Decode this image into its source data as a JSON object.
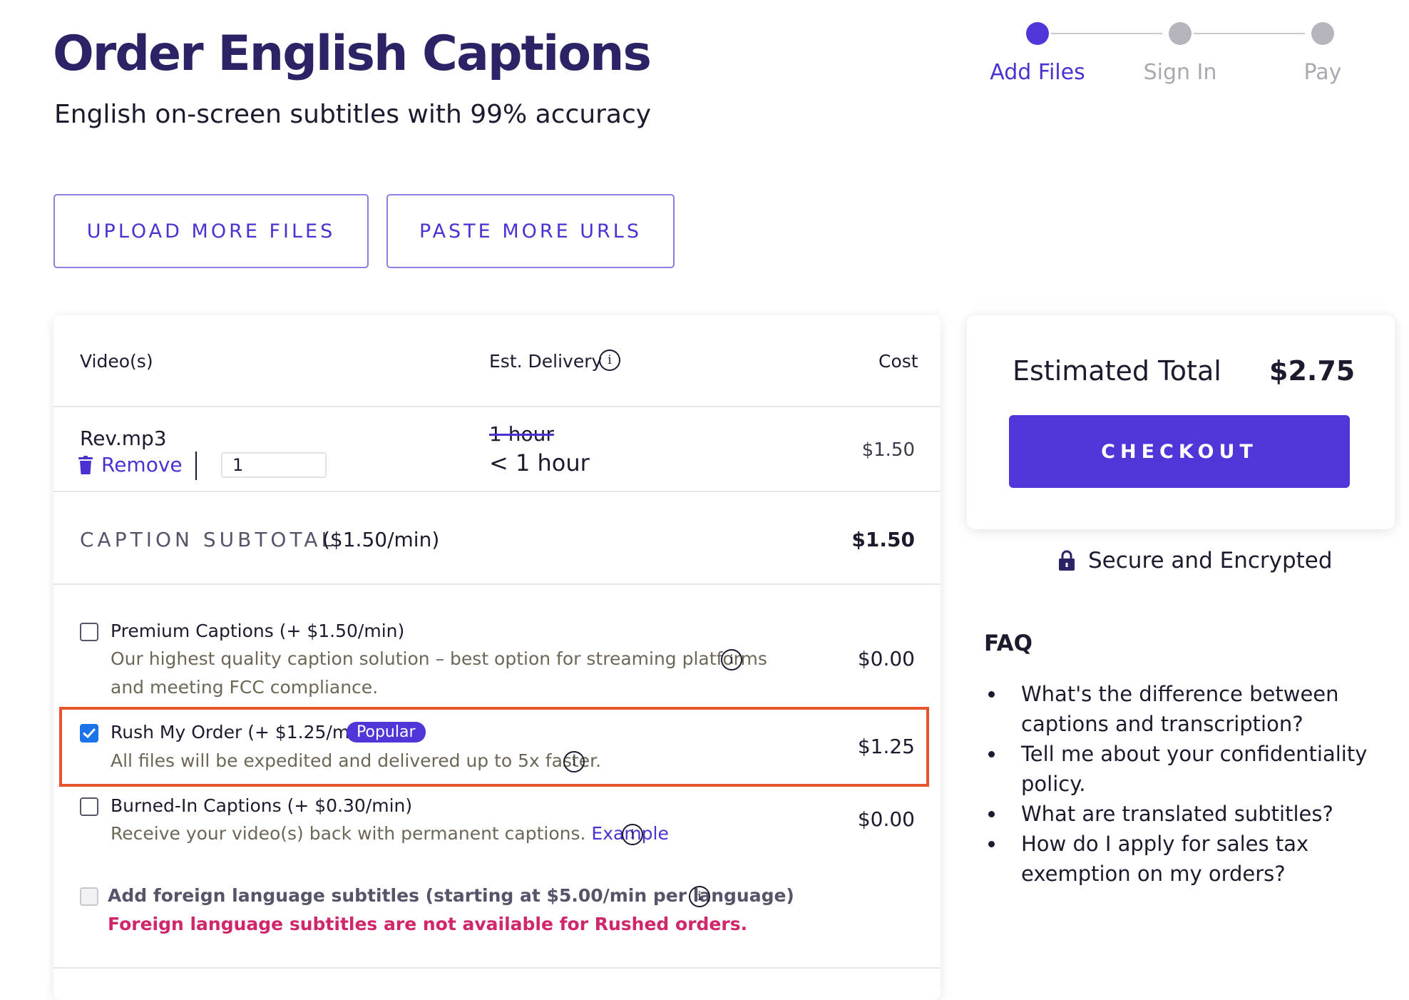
{
  "header": {
    "title": "Order English Captions",
    "subtitle": "English on-screen subtitles with 99% accuracy"
  },
  "stepper": {
    "steps": [
      {
        "label": "Add Files",
        "active": true
      },
      {
        "label": "Sign In",
        "active": false
      },
      {
        "label": "Pay",
        "active": false
      }
    ]
  },
  "actions": {
    "upload_label": "UPLOAD MORE FILES",
    "paste_label": "PASTE MORE URLS"
  },
  "table": {
    "col_videos": "Video(s)",
    "col_delivery": "Est. Delivery",
    "col_cost": "Cost",
    "info_glyph": "i"
  },
  "file": {
    "name": "Rev.mp3",
    "remove_label": "Remove",
    "quantity": "1",
    "delivery_old": "1 hour",
    "delivery_new": "< 1 hour",
    "cost": "$1.50"
  },
  "subtotal": {
    "label": "CAPTION SUBTOTAL",
    "rate": "($1.50/min)",
    "value": "$1.50"
  },
  "options": {
    "premium": {
      "title": "Premium Captions (+ $1.50/min)",
      "desc_line1": "Our highest quality caption solution – best option for streaming platforms",
      "desc_line2": "and meeting FCC compliance.",
      "price": "$0.00",
      "checked": false
    },
    "rush": {
      "title": "Rush My Order (+ $1.25/min)",
      "badge": "Popular",
      "desc": "All files will be expedited and delivered up to 5x faster.",
      "price": "$1.25",
      "checked": true
    },
    "burned": {
      "title": "Burned-In Captions (+ $0.30/min)",
      "desc": "Receive your video(s) back with permanent captions.",
      "link": "Example",
      "price": "$0.00",
      "checked": false
    },
    "foreign": {
      "title": "Add foreign language subtitles (starting at $5.00/min per language)",
      "warning": "Foreign language subtitles are not available for Rushed orders.",
      "checked": false,
      "disabled": true
    }
  },
  "summary": {
    "total_label": "Estimated Total",
    "total_value": "$2.75",
    "checkout_label": "CHECKOUT",
    "secure_label": "Secure and Encrypted"
  },
  "faq": {
    "title": "FAQ",
    "items": [
      "What's the difference between captions and transcription?",
      "Tell me about your confidentiality policy.",
      "What are translated subtitles?",
      "How do I apply for sales tax exemption on my orders?"
    ]
  },
  "colors": {
    "brand": "#5035d8",
    "title": "#2a2466",
    "warning": "#d0266b",
    "highlight": "#e8542c"
  }
}
